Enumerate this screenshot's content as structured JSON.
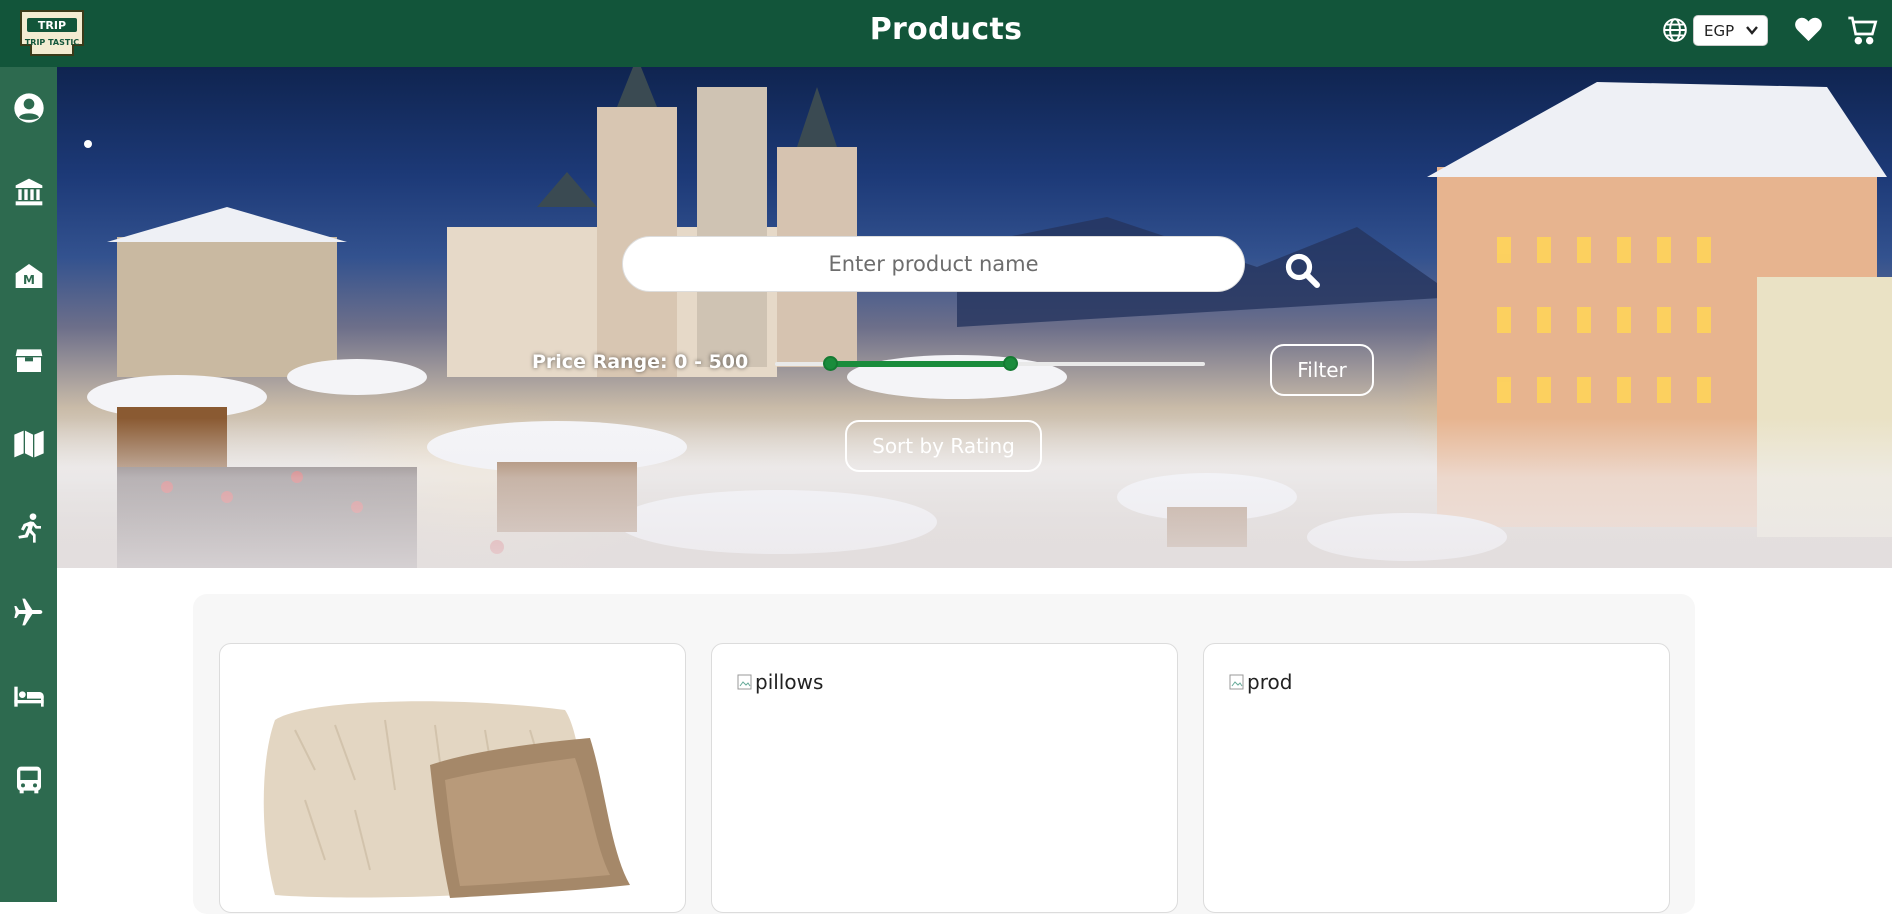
{
  "header": {
    "title": "Products",
    "logo_text_top": "TRIP",
    "logo_text_bottom": "TRIP TASTIC",
    "currency": "EGP"
  },
  "sidebar": {
    "items": [
      {
        "icon": "user-icon"
      },
      {
        "icon": "museum-icon"
      },
      {
        "icon": "landmark-icon"
      },
      {
        "icon": "box-icon"
      },
      {
        "icon": "map-icon"
      },
      {
        "icon": "running-icon"
      },
      {
        "icon": "plane-icon"
      },
      {
        "icon": "bed-icon"
      },
      {
        "icon": "bus-icon"
      }
    ]
  },
  "filters": {
    "search_placeholder": "Enter product name",
    "price_range_label": "Price Range: 0 - 500",
    "price_min": 0,
    "price_max": 500,
    "filter_label": "Filter",
    "sort_label": "Sort by Rating"
  },
  "products": [
    {
      "alt": "",
      "has_image": true
    },
    {
      "alt": "pillows",
      "has_image": false
    },
    {
      "alt": "prod",
      "has_image": false
    }
  ],
  "colors": {
    "header_bg": "#12553a",
    "sidebar_bg": "#2d6a4f",
    "accent": "#1a8c3c"
  }
}
